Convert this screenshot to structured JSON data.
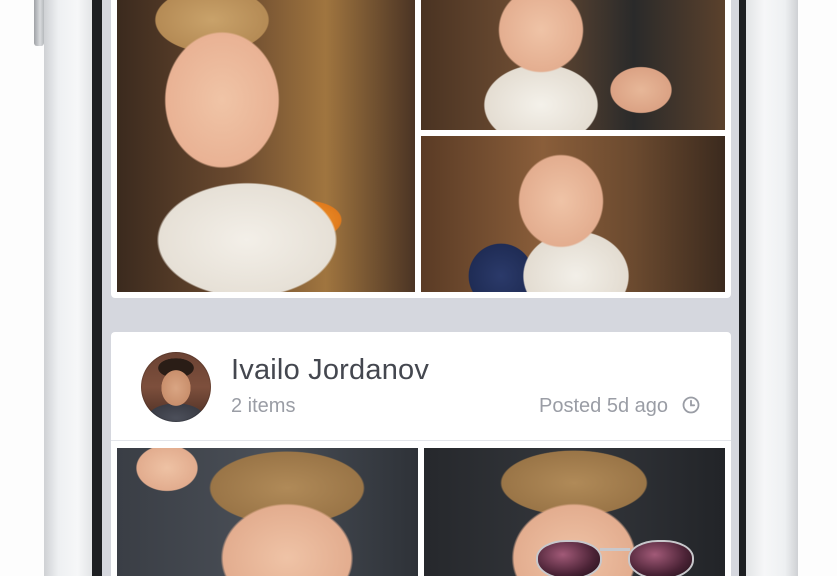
{
  "feed": {
    "post_previous": {
      "photos": [
        {
          "icon": "photo-toddler-eating-mango"
        },
        {
          "icon": "photo-toddler-eating-closeup"
        },
        {
          "icon": "photo-toddler-at-table"
        }
      ]
    },
    "post": {
      "author_name": "Ivailo Jordanov",
      "item_count": "2 items",
      "posted_label": "Posted 5d ago",
      "time_icon": "clock-icon",
      "photos": [
        {
          "icon": "photo-toddler-hand-on-head"
        },
        {
          "icon": "photo-toddler-sunglasses"
        }
      ]
    }
  },
  "colors": {
    "screen_background": "#d5d7de",
    "card_background": "#ffffff",
    "name_text": "#44474f",
    "meta_text": "#9a9da5"
  }
}
